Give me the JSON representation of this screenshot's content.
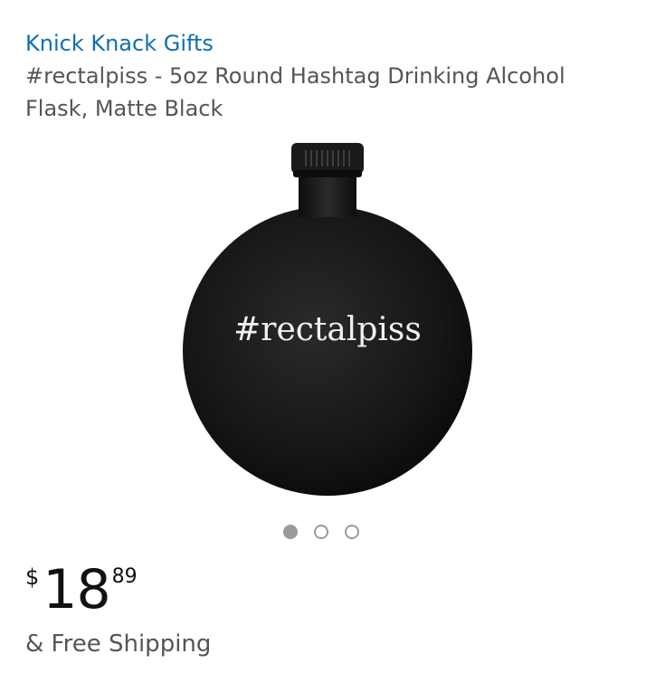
{
  "product": {
    "brand": "Knick Knack Gifts",
    "title": "#rectalpiss - 5oz Round Hashtag Drinking Alcohol Flask, Matte Black",
    "image": {
      "engraving": "#rectalpiss",
      "color": "#111111"
    },
    "carousel": {
      "count": 3,
      "active_index": 0
    },
    "price": {
      "symbol": "$",
      "whole": "18",
      "fraction": "89"
    },
    "shipping": "& Free Shipping"
  },
  "colors": {
    "brand_link": "#0f6fb3",
    "title_text": "#555555",
    "price_text": "#111111",
    "dot": "#9a9a9a"
  }
}
